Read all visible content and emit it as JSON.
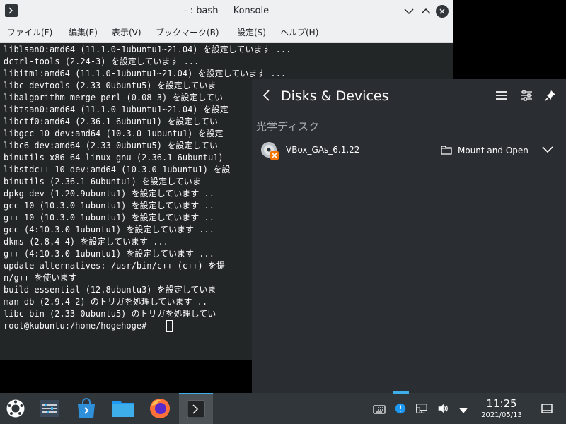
{
  "window": {
    "title": "- : bash — Konsole"
  },
  "menubar": [
    {
      "label": "ファイル(F)"
    },
    {
      "label": "編集(E)"
    },
    {
      "label": "表示(V)"
    },
    {
      "label": "ブックマーク(B)"
    },
    {
      "label": "設定(S)"
    },
    {
      "label": "ヘルプ(H)"
    }
  ],
  "terminal": {
    "lines": [
      "liblsan0:amd64 (11.1.0-1ubuntu1~21.04) を設定しています ...",
      "dctrl-tools (2.24-3) を設定しています ...",
      "libitm1:amd64 (11.1.0-1ubuntu1~21.04) を設定しています ...",
      "libc-devtools (2.33-0ubuntu5) を設定していま",
      "libalgorithm-merge-perl (0.08-3) を設定してい",
      "libtsan0:amd64 (11.1.0-1ubuntu1~21.04) を設定",
      "libctf0:amd64 (2.36.1-6ubuntu1) を設定してい",
      "libgcc-10-dev:amd64 (10.3.0-1ubuntu1) を設定",
      "libc6-dev:amd64 (2.33-0ubuntu5) を設定してい",
      "binutils-x86-64-linux-gnu (2.36.1-6ubuntu1)",
      "libstdc++-10-dev:amd64 (10.3.0-1ubuntu1) を設",
      "binutils (2.36.1-6ubuntu1) を設定していま",
      "dpkg-dev (1.20.9ubuntu1) を設定しています ..",
      "gcc-10 (10.3.0-1ubuntu1) を設定しています ..",
      "g++-10 (10.3.0-1ubuntu1) を設定しています ..",
      "gcc (4:10.3.0-1ubuntu1) を設定しています ...",
      "dkms (2.8.4-4) を設定しています ...",
      "g++ (4:10.3.0-1ubuntu1) を設定しています ...",
      "update-alternatives: /usr/bin/c++ (c++) を提",
      "n/g++ を使います",
      "build-essential (12.8ubuntu3) を設定していま",
      "man-db (2.9.4-2) のトリガを処理しています ..",
      "libc-bin (2.33-0ubuntu5) のトリガを処理してい",
      "root@kubuntu:/home/hogehoge# "
    ]
  },
  "popup": {
    "title": "Disks & Devices",
    "section": "光学ディスク",
    "device": {
      "name": "VBox_GAs_6.1.22",
      "action": "Mount and Open"
    }
  },
  "taskbar": {
    "time": "11:25",
    "date": "2021/05/13"
  },
  "colors": {
    "accent": "#3daee9",
    "terminal_bg": "#232627",
    "popup_bg": "#2a2e32",
    "taskbar_bg": "#31363b"
  }
}
